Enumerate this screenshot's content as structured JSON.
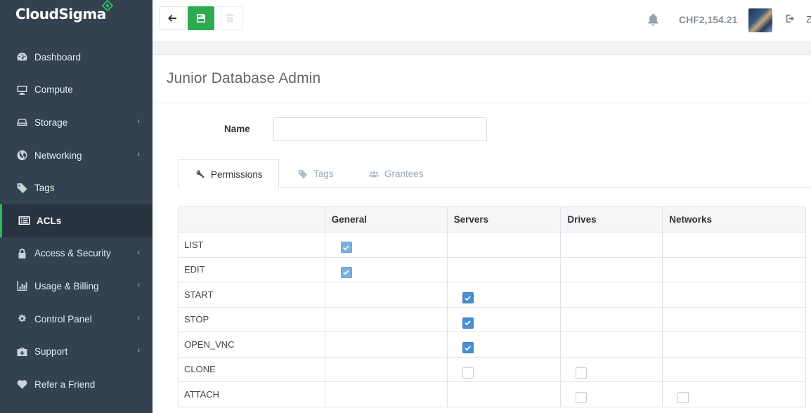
{
  "brand": {
    "name": "CloudSigma"
  },
  "sidebar": {
    "items": [
      {
        "label": "Dashboard",
        "icon": "dashboard-icon",
        "has_submenu": false
      },
      {
        "label": "Compute",
        "icon": "monitor-icon",
        "has_submenu": false
      },
      {
        "label": "Storage",
        "icon": "hdd-icon",
        "has_submenu": true
      },
      {
        "label": "Networking",
        "icon": "globe-icon",
        "has_submenu": true
      },
      {
        "label": "Tags",
        "icon": "tags-icon",
        "has_submenu": false
      },
      {
        "label": "ACLs",
        "icon": "list-alt-icon",
        "has_submenu": false,
        "active": true
      },
      {
        "label": "Access & Security",
        "icon": "lock-icon",
        "has_submenu": true
      },
      {
        "label": "Usage & Billing",
        "icon": "bar-chart-icon",
        "has_submenu": true
      },
      {
        "label": "Control Panel",
        "icon": "cogs-icon",
        "has_submenu": true
      },
      {
        "label": "Support",
        "icon": "medkit-icon",
        "has_submenu": true
      },
      {
        "label": "Refer a Friend",
        "icon": "heart-icon",
        "has_submenu": false
      }
    ]
  },
  "toolbar": {
    "back_icon": "arrow-left-icon",
    "save_icon": "floppy-icon",
    "delete_icon": "trash-icon"
  },
  "header": {
    "bell_icon": "bell-icon",
    "balance": "CHF2,154.21",
    "logout_icon": "sign-out-icon",
    "user_initial": "Z"
  },
  "page": {
    "title": "Junior Database Admin",
    "name_label": "Name",
    "name_value": ""
  },
  "tabs": [
    {
      "label": "Permissions",
      "icon": "key-icon",
      "active": true
    },
    {
      "label": "Tags",
      "icon": "tags-icon",
      "active": false
    },
    {
      "label": "Grantees",
      "icon": "users-icon",
      "active": false
    }
  ],
  "permissions": {
    "columns": [
      "",
      "General",
      "Servers",
      "Drives",
      "Networks"
    ],
    "rows": [
      {
        "name": "LIST",
        "general": "checked-disabled",
        "servers": null,
        "drives": null,
        "networks": null
      },
      {
        "name": "EDIT",
        "general": "checked-disabled",
        "servers": null,
        "drives": null,
        "networks": null
      },
      {
        "name": "START",
        "general": null,
        "servers": "checked",
        "drives": null,
        "networks": null
      },
      {
        "name": "STOP",
        "general": null,
        "servers": "checked",
        "drives": null,
        "networks": null
      },
      {
        "name": "OPEN_VNC",
        "general": null,
        "servers": "checked",
        "drives": null,
        "networks": null
      },
      {
        "name": "CLONE",
        "general": null,
        "servers": "unchecked",
        "drives": "unchecked",
        "networks": null
      },
      {
        "name": "ATTACH",
        "general": null,
        "servers": null,
        "drives": "unchecked",
        "networks": "unchecked"
      }
    ]
  },
  "colors": {
    "sidebar_bg": "#334150",
    "sidebar_active_bg": "#283440",
    "accent_green": "#2eb85c",
    "save_button": "#2eaa4f",
    "checkbox_blue": "#4a8ed0"
  }
}
